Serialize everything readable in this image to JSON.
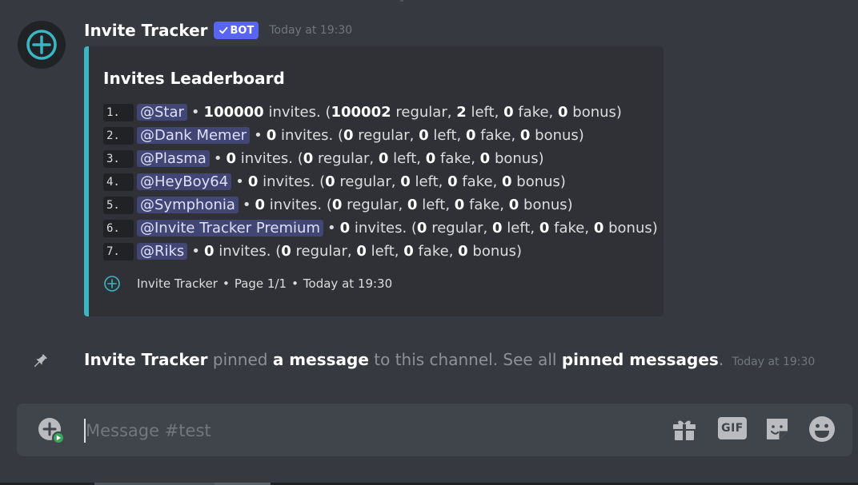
{
  "message": {
    "author": "Invite Tracker",
    "bot_tag": "BOT",
    "timestamp": "Today at 19:30",
    "embed": {
      "accent_color": "#3bb6c4",
      "title": "Invites Leaderboard",
      "rows": [
        {
          "rank": "1.",
          "mention": "@Star",
          "invites": "100000",
          "regular": "100002",
          "left": "2",
          "fake": "0",
          "bonus": "0"
        },
        {
          "rank": "2.",
          "mention": "@Dank Memer",
          "invites": "0",
          "regular": "0",
          "left": "0",
          "fake": "0",
          "bonus": "0"
        },
        {
          "rank": "3.",
          "mention": "@Plasma",
          "invites": "0",
          "regular": "0",
          "left": "0",
          "fake": "0",
          "bonus": "0"
        },
        {
          "rank": "4.",
          "mention": "@HeyBoy64",
          "invites": "0",
          "regular": "0",
          "left": "0",
          "fake": "0",
          "bonus": "0"
        },
        {
          "rank": "5.",
          "mention": "@Symphonia",
          "invites": "0",
          "regular": "0",
          "left": "0",
          "fake": "0",
          "bonus": "0"
        },
        {
          "rank": "6.",
          "mention": "@Invite Tracker Premium",
          "invites": "0",
          "regular": "0",
          "left": "0",
          "fake": "0",
          "bonus": "0"
        },
        {
          "rank": "7.",
          "mention": "@Riks",
          "invites": "0",
          "regular": "0",
          "left": "0",
          "fake": "0",
          "bonus": "0"
        }
      ],
      "row_text": {
        "bullet": "•",
        "invites": "invites. (",
        "regular": "regular,",
        "left": "left,",
        "fake": "fake,",
        "bonus": "bonus)"
      },
      "footer": {
        "author": "Invite Tracker",
        "page": "Page 1/1",
        "time": "Today at 19:30",
        "separator": "•"
      }
    }
  },
  "system_message": {
    "author": "Invite Tracker",
    "text_1": "pinned",
    "link_1": "a message",
    "text_2": "to this channel. See all",
    "link_2": "pinned messages",
    "text_3": ".",
    "timestamp": "Today at 19:30",
    "icon": "pin-icon"
  },
  "composer": {
    "placeholder": "Message #test",
    "gif_label": "GIF",
    "icons": [
      "upload-icon",
      "gift-icon",
      "gif-icon",
      "sticker-icon",
      "emoji-icon"
    ]
  }
}
